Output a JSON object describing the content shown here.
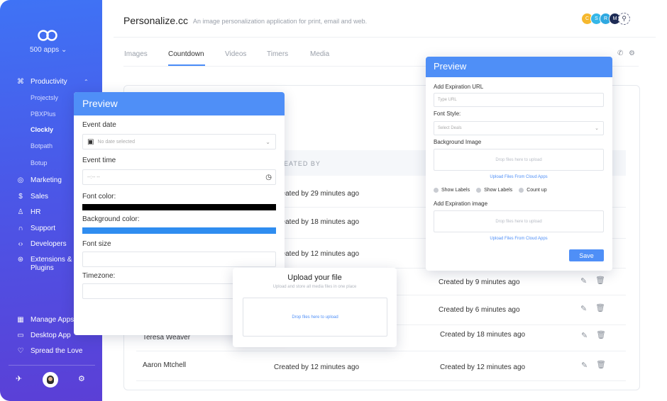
{
  "sidebar": {
    "apps_label": "500 apps",
    "items": [
      {
        "icon": "command-icon",
        "label": "Productivity"
      },
      {
        "icon": "globe-icon",
        "label": "Marketing"
      },
      {
        "icon": "dollar-icon",
        "label": "Sales"
      },
      {
        "icon": "user-icon",
        "label": "HR"
      },
      {
        "icon": "headset-icon",
        "label": "Support"
      },
      {
        "icon": "code-icon",
        "label": "Developers"
      },
      {
        "icon": "extensions-icon",
        "label": "Extensions &",
        "label2": "Plugins"
      },
      {
        "icon": "grid-icon",
        "label": "Manage Apps"
      },
      {
        "icon": "monitor-icon",
        "label": "Desktop App"
      },
      {
        "icon": "heart-icon",
        "label": "Spread the Love"
      }
    ],
    "sub_items": [
      "Projectsly",
      "PBXPlus",
      "Clockly",
      "Botpath",
      "Botup"
    ],
    "active_sub": "Clockly"
  },
  "header": {
    "title": "Personalize.cc",
    "subtitle": "An image personalization application for print, email and web.",
    "avatars": [
      {
        "letter": "C",
        "color": "#f5b82e"
      },
      {
        "letter": "S",
        "color": "#35b7e8"
      },
      {
        "letter": "R",
        "color": "#2fa8e0"
      },
      {
        "letter": "M",
        "color": "#1d2b55"
      }
    ]
  },
  "tabs": [
    "Images",
    "Countdown",
    "Videos",
    "Timers",
    "Media"
  ],
  "active_tab": "Countdown",
  "table": {
    "col_created_by": "CREATED BY",
    "rows": [
      {
        "name": "",
        "c1": "Created by 29 minutes ago",
        "c2": ""
      },
      {
        "name": "",
        "c1": "Created by 18 minutes ago",
        "c2": ""
      },
      {
        "name": "",
        "c1": "Created by 12 minutes ago",
        "c2": ""
      },
      {
        "name": "",
        "c1": "",
        "c2": "Created by 9 minutes ago"
      },
      {
        "name": "",
        "c1": "",
        "c2": "Created by 6 minutes ago"
      },
      {
        "name": "Teresa Weaver",
        "c1": "",
        "c2": "Created by 18 minutes ago"
      },
      {
        "name": "Aaron Mtchell",
        "c1": "Created by 12 minutes ago",
        "c2": "Created by 12 minutes ago"
      }
    ]
  },
  "preview_left": {
    "title": "Preview",
    "event_date_label": "Event date",
    "event_date_placeholder": "No date selected",
    "event_time_label": "Event time",
    "event_time_placeholder": "--:-- --",
    "font_color_label": "Font color:",
    "font_color": "#000000",
    "bg_color_label": "Background color:",
    "bg_color": "#2f8df0",
    "font_size_label": "Font size",
    "timezone_label": "Timezone:"
  },
  "preview_right": {
    "title": "Preview",
    "exp_url_label": "Add Expiration URL",
    "exp_url_placeholder": "Type URL",
    "font_style_label": "Font Style:",
    "font_style_placeholder": "Select Deals",
    "bg_image_label": "Background Image",
    "drop_text": "Drop files here to upload",
    "cloud_link": "Upload Files From Cloud Apps",
    "radios": [
      "Show Labels",
      "Show Labels",
      "Count up"
    ],
    "exp_image_label": "Add Expiration image",
    "save_label": "Save"
  },
  "upload": {
    "title": "Upload your file",
    "subtitle": "Upload and store all media files in one place",
    "drop_text": "Drop files here to upload"
  }
}
